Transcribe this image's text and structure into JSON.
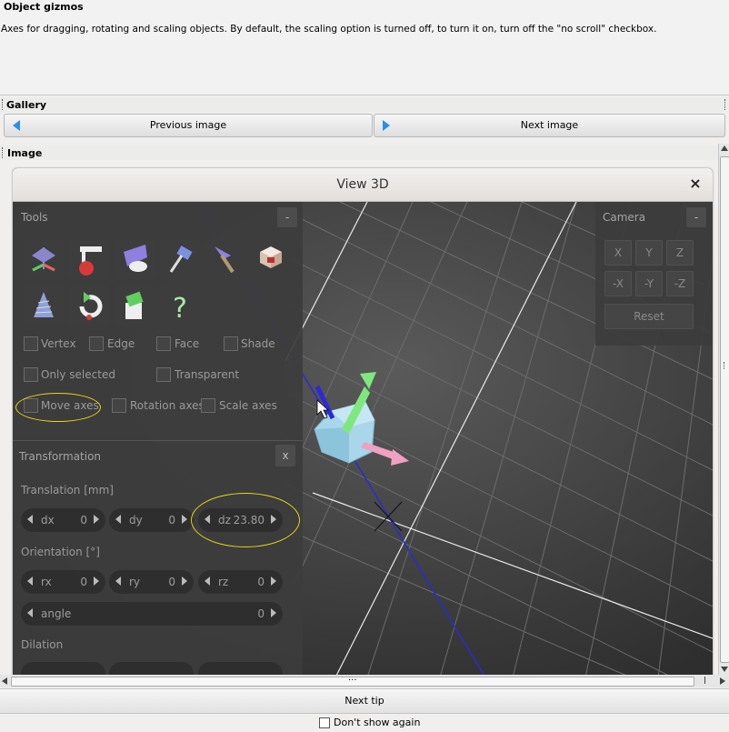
{
  "description": {
    "title": "Object gizmos",
    "text": "Axes for dragging, rotating and scaling objects. By default, the scaling option is turned off, to turn it on, turn off the \"no scroll\" checkbox."
  },
  "gallery": {
    "label": "Gallery",
    "previous_label": "Previous image",
    "next_label": "Next image"
  },
  "image_section": {
    "label": "Image"
  },
  "view3d": {
    "title": "View 3D",
    "close_label": "×",
    "tools": {
      "title": "Tools",
      "collapse_label": "-",
      "checkboxes_row1": [
        "Vertex",
        "Edge",
        "Face",
        "Shade"
      ],
      "only_selected": "Only selected",
      "transparent": "Transparent",
      "move_axes": "Move axes",
      "rotation_axes": "Rotation axes",
      "scale_axes": "Scale axes",
      "icons": [
        "move-tool",
        "measure-tool",
        "cut-tool",
        "hammer-tool",
        "pointer-tool",
        "block-tool",
        "drill-tool",
        "undo-tool",
        "bucket-tool",
        "help-tool"
      ]
    },
    "transformation": {
      "title": "Transformation",
      "close_label": "x",
      "translation_label": "Translation [mm]",
      "dx": {
        "label": "dx",
        "value": "0"
      },
      "dy": {
        "label": "dy",
        "value": "0"
      },
      "dz": {
        "label": "dz",
        "value": "23.80"
      },
      "orientation_label": "Orientation [°]",
      "rx": {
        "label": "rx",
        "value": "0"
      },
      "ry": {
        "label": "ry",
        "value": "0"
      },
      "rz": {
        "label": "rz",
        "value": "0"
      },
      "angle": {
        "label": "angle",
        "value": "0"
      },
      "dilation_label": "Dilation"
    },
    "camera": {
      "title": "Camera",
      "collapse_label": "-",
      "keys_row1": [
        "X",
        "Y",
        "Z"
      ],
      "keys_row2": [
        "-X",
        "-Y",
        "-Z"
      ],
      "reset_label": "Reset"
    }
  },
  "hscroll": {
    "dots": "..."
  },
  "footer": {
    "next_tip_label": "Next tip",
    "dont_show_label": "Don't show again"
  },
  "colors": {
    "accent_blue": "#2a8fe8",
    "highlight_yellow": "#e4d718",
    "viewport_bg": "#4a4a4a",
    "axis_blue": "#2a2ad8",
    "gizmo_green": "#7ee87e",
    "gizmo_pink": "#f0a0c0",
    "object_cyan": "#9ccfe6"
  }
}
